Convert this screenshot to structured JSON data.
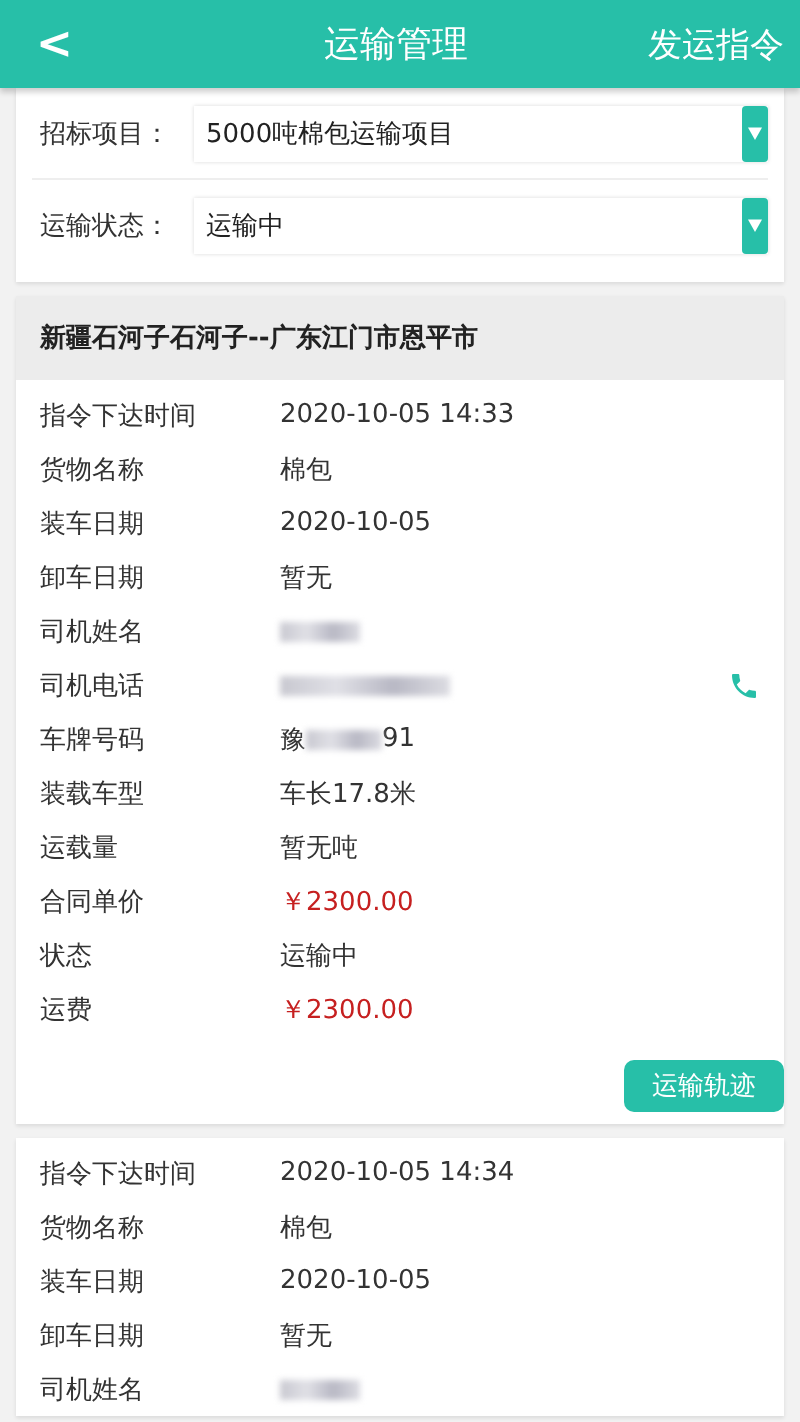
{
  "header": {
    "back": "<",
    "title": "运输管理",
    "action": "发运指令"
  },
  "filters": [
    {
      "label": "招标项目：",
      "value": "5000吨棉包运输项目"
    },
    {
      "label": "运输状态：",
      "value": "运输中"
    }
  ],
  "orders": [
    {
      "route": "新疆石河子石河子--广东江门市恩平市",
      "button": "运输轨迹",
      "rows": [
        {
          "kind": "text",
          "label": "指令下达时间",
          "value": "2020-10-05 14:33"
        },
        {
          "kind": "text",
          "label": "货物名称",
          "value": "棉包"
        },
        {
          "kind": "text",
          "label": "装车日期",
          "value": "2020-10-05"
        },
        {
          "kind": "text",
          "label": "卸车日期",
          "value": "暂无"
        },
        {
          "kind": "redacted",
          "label": "司机姓名"
        },
        {
          "kind": "phone",
          "label": "司机电话"
        },
        {
          "kind": "partial",
          "label": "车牌号码",
          "prefix": "豫",
          "suffix": "91"
        },
        {
          "kind": "text",
          "label": "装载车型",
          "value": "车长17.8米"
        },
        {
          "kind": "text",
          "label": "运载量",
          "value": "暂无吨"
        },
        {
          "kind": "money",
          "label": "合同单价",
          "value": "￥2300.00"
        },
        {
          "kind": "text",
          "label": "状态",
          "value": "运输中"
        },
        {
          "kind": "money",
          "label": "运费",
          "value": "￥2300.00"
        }
      ]
    },
    {
      "rows": [
        {
          "kind": "text",
          "label": "指令下达时间",
          "value": "2020-10-05 14:34"
        },
        {
          "kind": "text",
          "label": "货物名称",
          "value": "棉包"
        },
        {
          "kind": "text",
          "label": "装车日期",
          "value": "2020-10-05"
        },
        {
          "kind": "text",
          "label": "卸车日期",
          "value": "暂无"
        },
        {
          "kind": "redacted",
          "label": "司机姓名"
        }
      ]
    }
  ]
}
